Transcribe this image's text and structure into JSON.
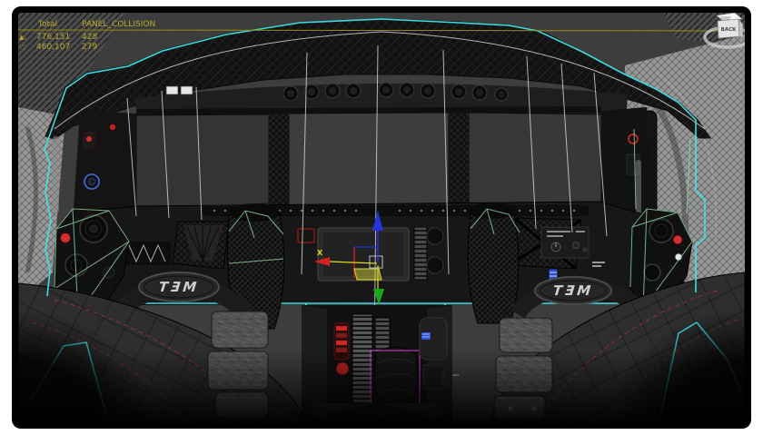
{
  "stats": {
    "columns": [
      "Total",
      "PANEL_COLLISION"
    ],
    "rows": [
      {
        "label": "▲:",
        "total": "776,151",
        "selected": "428"
      },
      {
        "label": "∵:",
        "total": "460,107",
        "selected": "279"
      }
    ]
  },
  "viewcube": {
    "face_label": "BACK"
  },
  "gizmo": {
    "x_label": "X"
  },
  "logos": {
    "left": "TƎM",
    "right": "TƎM"
  },
  "selected_object": "PANEL_COLLISION",
  "colors": {
    "selection_cyan": "#3ee6ec",
    "wire_green": "#96d8a8",
    "wire_white": "#dcdcdc",
    "magenta": "#c840c8",
    "axis_red": "#d82020",
    "axis_green": "#1aa81a",
    "axis_blue": "#2335d8",
    "axis_yellow": "#ded81e",
    "stats_yellow": "#b8a82a",
    "separator_yellow": "#938c10",
    "red_accent": "#d03030",
    "blue_accent": "#3a5fd0",
    "viewport_bg": "#3d3d3d"
  }
}
